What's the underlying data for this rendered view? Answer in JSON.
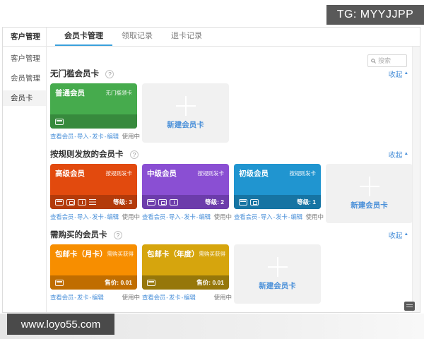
{
  "overlays": {
    "tg_label": "TG: MYYJJPP",
    "watermark": "www.loyo55.com"
  },
  "sidebar": {
    "header": "客户管理",
    "items": [
      {
        "label": "客户管理",
        "active": false
      },
      {
        "label": "会员管理",
        "active": false
      },
      {
        "label": "会员卡",
        "active": true
      }
    ]
  },
  "tabs": [
    {
      "label": "会员卡管理",
      "active": true
    },
    {
      "label": "领取记录",
      "active": false
    },
    {
      "label": "退卡记录",
      "active": false
    }
  ],
  "search": {
    "placeholder": "搜索"
  },
  "sections": [
    {
      "title": "无门槛会员卡",
      "collapse_label": "收起",
      "new_card_label": "新建会员卡",
      "cards": [
        {
          "title": "普通会员",
          "badge": "无门槛领卡",
          "color": "#46ab4d",
          "strip_color": "#378a3d",
          "icons": [
            "card"
          ],
          "meta": "",
          "links": [
            "查看会员",
            "导入",
            "发卡",
            "编辑"
          ],
          "status": "使用中"
        }
      ]
    },
    {
      "title": "按规则发放的会员卡",
      "collapse_label": "收起",
      "new_card_label": "新建会员卡",
      "cards": [
        {
          "title": "高级会员",
          "badge": "按规则发卡",
          "color": "#e24a0e",
          "strip_color": "#b33a0a",
          "icons": [
            "card",
            "qrcode",
            "coupon",
            "list"
          ],
          "meta": "等级: 3",
          "links": [
            "查看会员",
            "导入",
            "发卡",
            "编辑"
          ],
          "status": "使用中"
        },
        {
          "title": "中级会员",
          "badge": "按规则发卡",
          "color": "#8a4fd3",
          "strip_color": "#6c3cab",
          "icons": [
            "card",
            "qrcode",
            "coupon"
          ],
          "meta": "等级: 2",
          "links": [
            "查看会员",
            "导入",
            "发卡",
            "编辑"
          ],
          "status": "使用中"
        },
        {
          "title": "初级会员",
          "badge": "按规则发卡",
          "color": "#2095d0",
          "strip_color": "#1674a3",
          "icons": [
            "card",
            "qrcode"
          ],
          "meta": "等级: 1",
          "links": [
            "查看会员",
            "导入",
            "发卡",
            "编辑"
          ],
          "status": "使用中"
        }
      ]
    },
    {
      "title": "需购买的会员卡",
      "collapse_label": "收起",
      "new_card_label": "新建会员卡",
      "cards": [
        {
          "title": "包邮卡（月卡）",
          "badge": "需购买获得",
          "color": "#f78e00",
          "strip_color": "#c06d00",
          "icons": [
            "card"
          ],
          "meta": "售价: 0.01",
          "links": [
            "查看会员",
            "发卡",
            "编辑"
          ],
          "status": "使用中"
        },
        {
          "title": "包邮卡（年度）",
          "badge": "需购买获得",
          "color": "#d6a50d",
          "strip_color": "#96770a",
          "icons": [
            "card"
          ],
          "meta": "售价: 0.01",
          "links": [
            "查看会员",
            "发卡",
            "编辑"
          ],
          "status": "使用中"
        }
      ]
    }
  ]
}
